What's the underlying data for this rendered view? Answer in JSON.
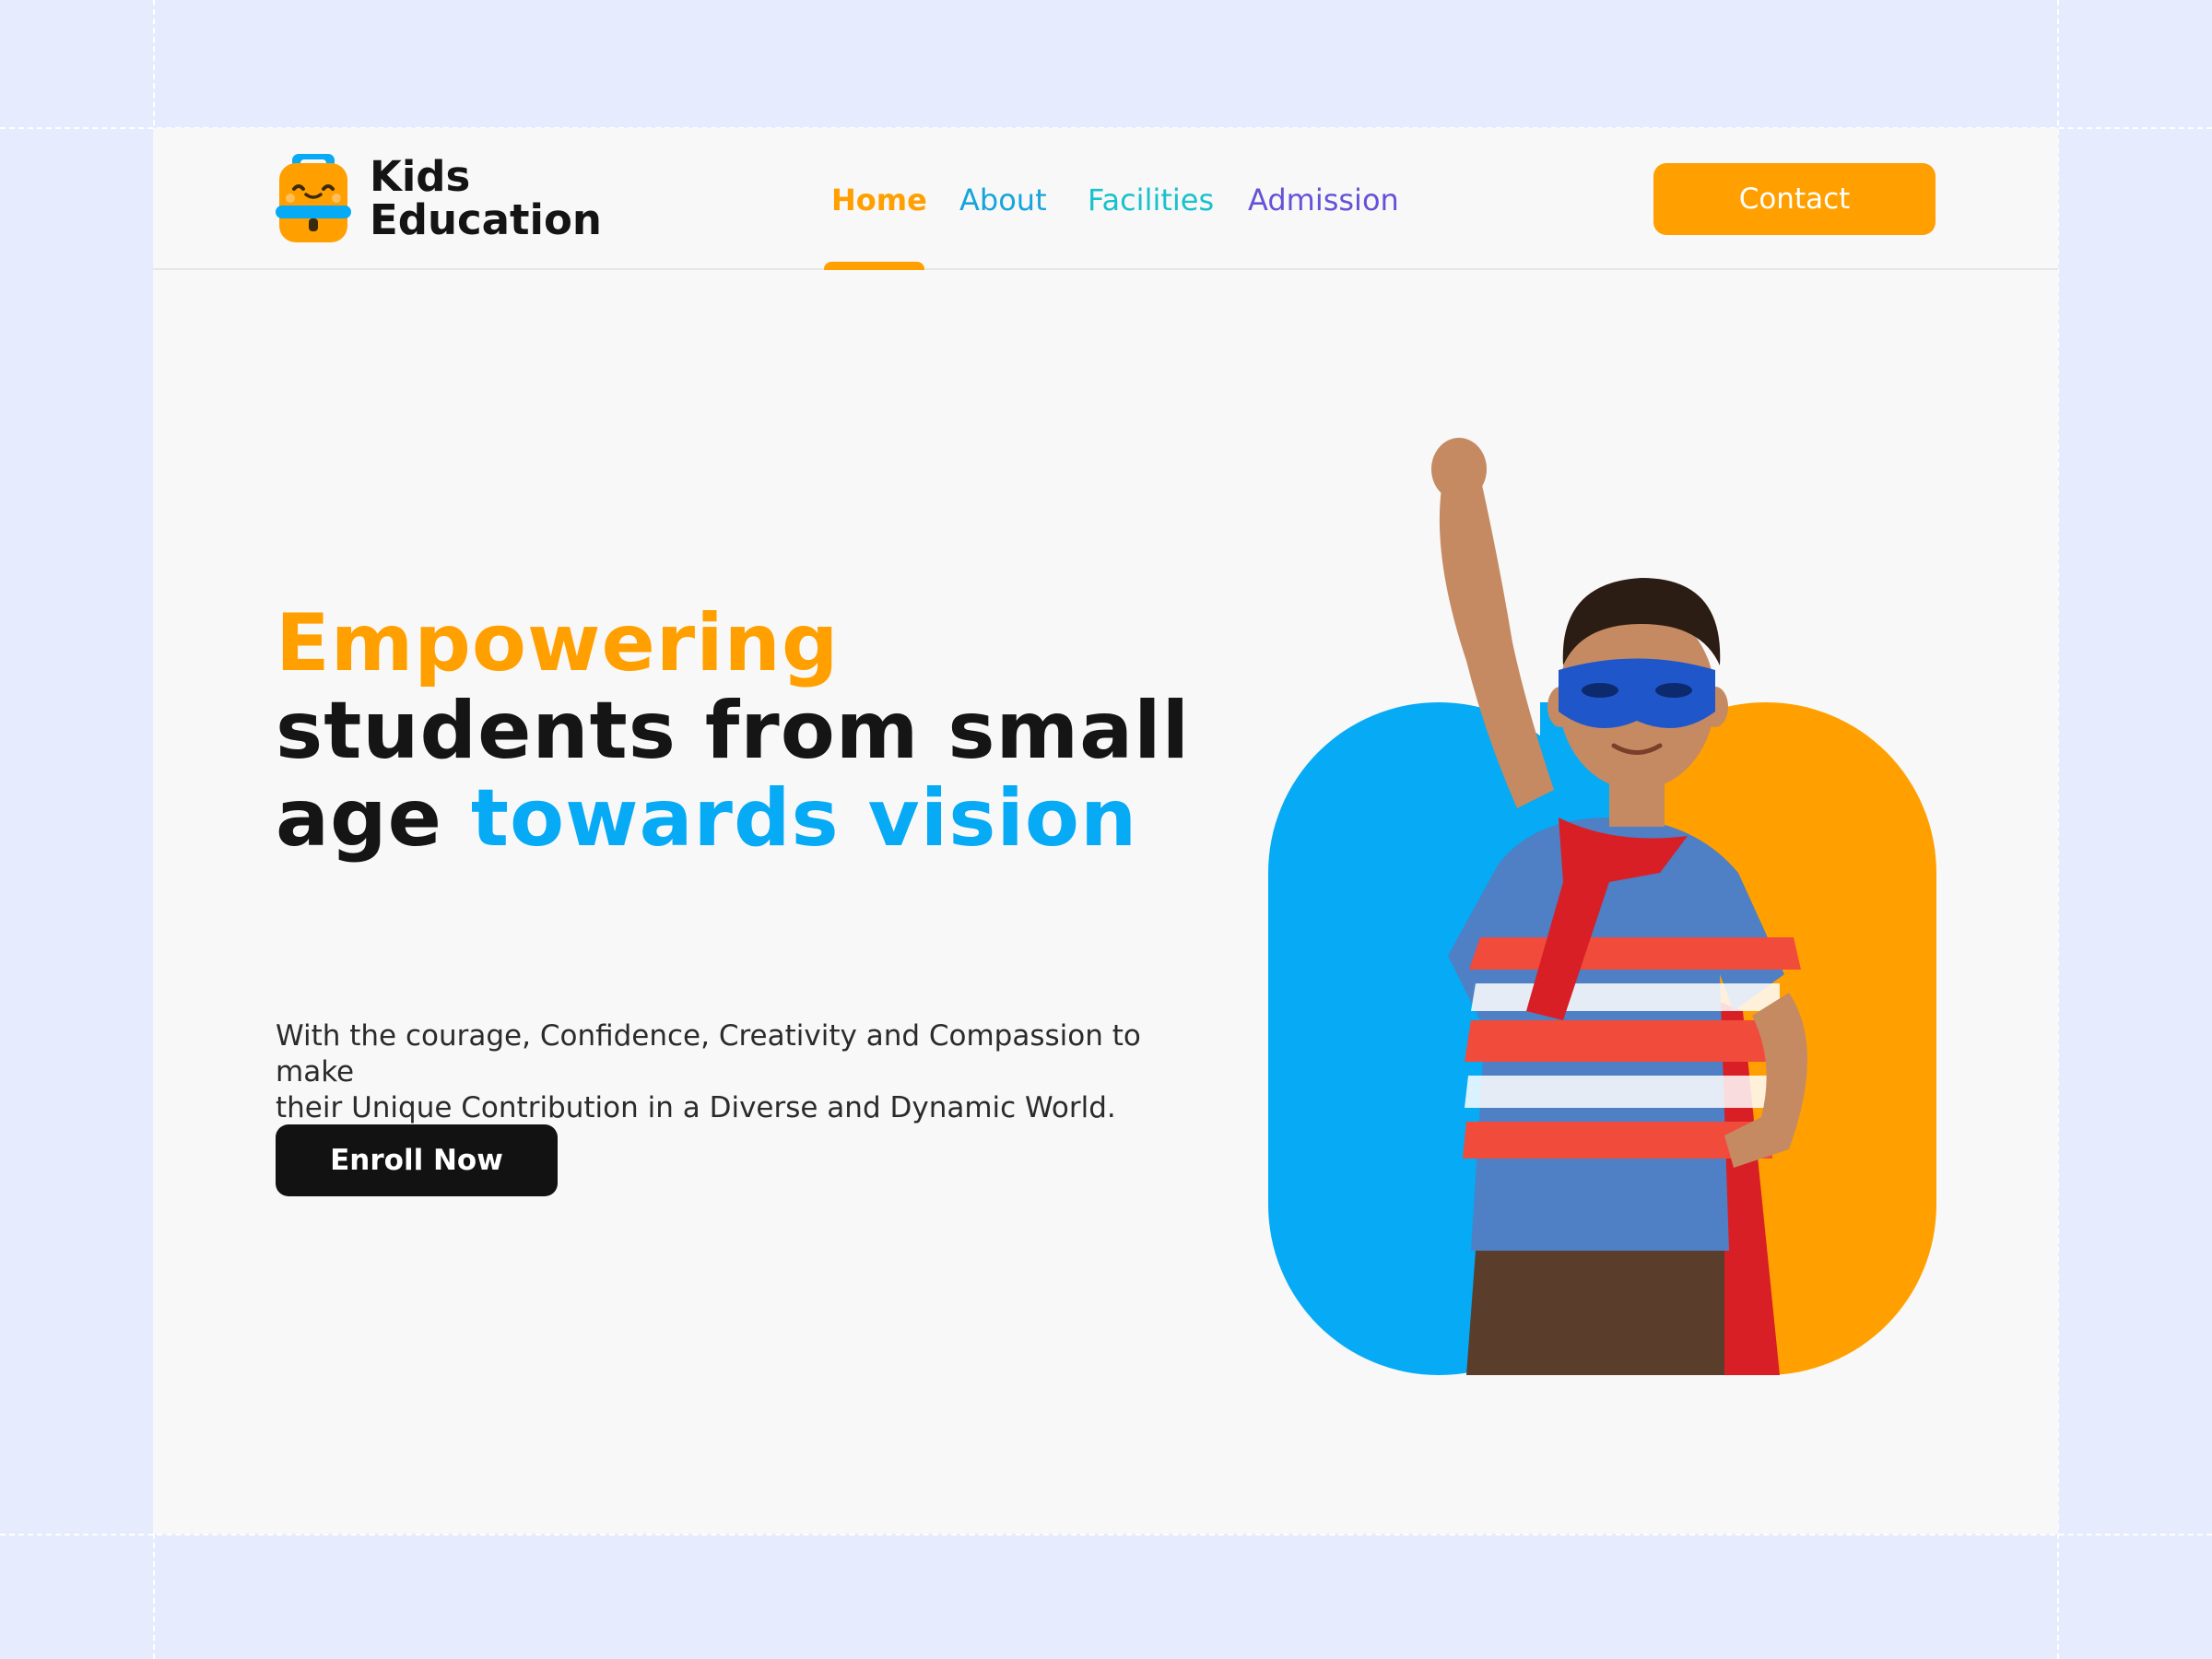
{
  "brand": {
    "name_line1": "Kids",
    "name_line2": "Education",
    "icon": "backpack-icon"
  },
  "nav": {
    "items": [
      {
        "label": "Home",
        "active": true,
        "color": "#ffa000"
      },
      {
        "label": "About",
        "active": false,
        "color": "#17a4dc"
      },
      {
        "label": "Facilities",
        "active": false,
        "color": "#19c1cc"
      },
      {
        "label": "Admission",
        "active": false,
        "color": "#6552d8"
      }
    ],
    "contact_label": "Contact"
  },
  "hero": {
    "title_highlight": "Empowering",
    "title_line2": "students from small",
    "title_line3_plain": "age ",
    "title_line3_accent": "towards vision",
    "subtitle_line1": "With the courage, Confidence, Creativity and Compassion to make",
    "subtitle_line2": "their Unique Contribution in a Diverse and Dynamic World.",
    "cta_label": "Enroll Now",
    "image": "superhero-kid-illustration"
  },
  "colors": {
    "accent_orange": "#ffa000",
    "accent_blue": "#06aaf5",
    "dark": "#121212",
    "page_bg": "#f8f8f8",
    "canvas_bg": "#e7ebfe"
  }
}
